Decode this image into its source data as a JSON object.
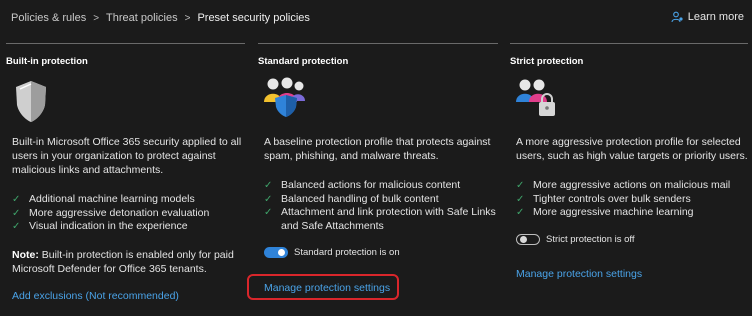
{
  "breadcrumb": [
    "Policies & rules",
    "Threat policies",
    "Preset security policies"
  ],
  "learn_more": "Learn more",
  "columns": [
    {
      "title": "Built-in protection",
      "description": "Built-in Microsoft Office 365 security applied to all users in your organization to protect against malicious links and attachments.",
      "features": [
        "Additional machine learning models",
        "More aggressive detonation evaluation",
        "Visual indication in the experience"
      ],
      "note_label": "Note:",
      "note_text": " Built-in protection is enabled only for paid Microsoft Defender for Office 365 tenants.",
      "link": "Add exclusions (Not recommended)"
    },
    {
      "title": "Standard protection",
      "description": "A baseline protection profile that protects against spam, phishing, and malware threats.",
      "features": [
        "Balanced actions for malicious content",
        "Balanced handling of bulk content",
        "Attachment and link protection with Safe Links and Safe Attachments"
      ],
      "toggle_label": "Standard protection is on",
      "toggle_on": true,
      "link": "Manage protection settings"
    },
    {
      "title": "Strict protection",
      "description": "A more aggressive protection profile for selected users, such as high value targets or priority users.",
      "features": [
        "More aggressive actions on malicious mail",
        "Tighter controls over bulk senders",
        "More aggressive machine learning"
      ],
      "toggle_label": "Strict protection is off",
      "toggle_on": false,
      "link": "Manage protection settings"
    }
  ],
  "colors": {
    "background": "#1b1b1b",
    "link": "#4aa3e8",
    "check": "#3fa36a",
    "toggle_on": "#2f83d9",
    "highlight": "#d9262b"
  },
  "icons": [
    "person-help-icon",
    "shield-icon",
    "users-shield-icon",
    "users-lock-icon",
    "checkmark-icon"
  ]
}
